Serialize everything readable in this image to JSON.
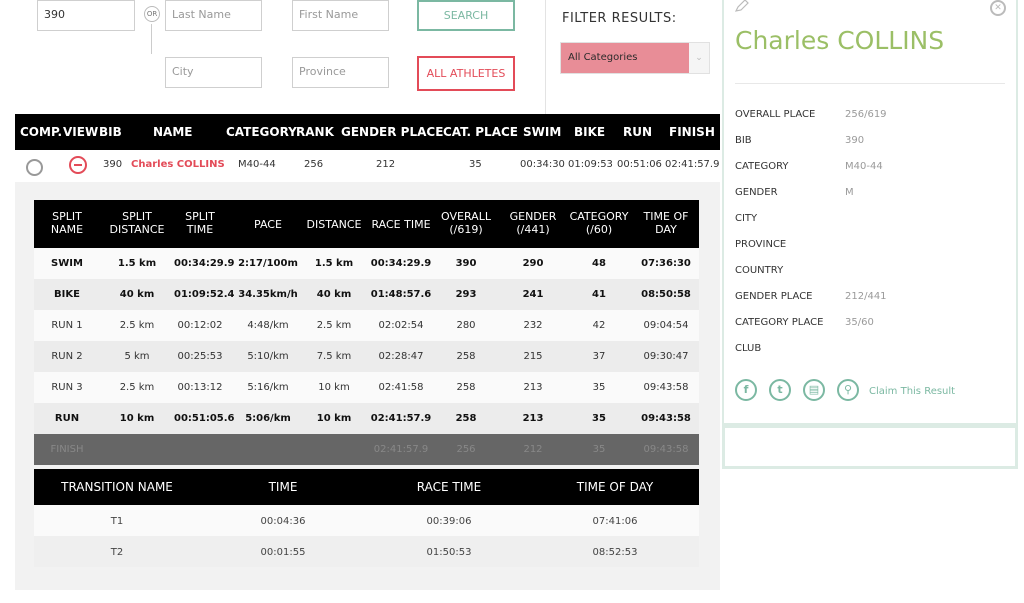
{
  "search": {
    "bib_value": "390",
    "or_label": "OR",
    "last_name_placeholder": "Last Name",
    "first_name_placeholder": "First Name",
    "city_placeholder": "City",
    "province_placeholder": "Province",
    "search_label": "SEARCH",
    "all_athletes_label": "ALL ATHLETES"
  },
  "filter": {
    "title": "FILTER RESULTS:",
    "selected": "All Categories"
  },
  "results": {
    "headers": [
      "COMP.",
      "VIEW",
      "BIB",
      "NAME",
      "CATEGORY",
      "RANK",
      "GENDER PLACE",
      "CAT. PLACE",
      "SWIM",
      "BIKE",
      "RUN",
      "FINISH"
    ],
    "row": {
      "bib": "390",
      "name": "Charles COLLINS",
      "category": "M40-44",
      "rank": "256",
      "gender_place": "212",
      "cat_place": "35",
      "swim": "00:34:30",
      "bike": "01:09:53",
      "run": "00:51:06",
      "finish": "02:41:57.9"
    }
  },
  "splits": {
    "headers": [
      "SPLIT NAME",
      "SPLIT DISTANCE",
      "SPLIT TIME",
      "PACE",
      "DISTANCE",
      "RACE TIME",
      "OVERALL (/619)",
      "GENDER (/441)",
      "CATEGORY (/60)",
      "TIME OF DAY"
    ],
    "rows": [
      {
        "bold": true,
        "cells": [
          "SWIM",
          "1.5 km",
          "00:34:29.9",
          "2:17/100m",
          "1.5 km",
          "00:34:29.9",
          "390",
          "290",
          "48",
          "07:36:30"
        ]
      },
      {
        "bold": true,
        "cells": [
          "BIKE",
          "40 km",
          "01:09:52.4",
          "34.35km/h",
          "40 km",
          "01:48:57.6",
          "293",
          "241",
          "41",
          "08:50:58"
        ]
      },
      {
        "bold": false,
        "cells": [
          "RUN 1",
          "2.5 km",
          "00:12:02",
          "4:48/km",
          "2.5 km",
          "02:02:54",
          "280",
          "232",
          "42",
          "09:04:54"
        ]
      },
      {
        "bold": false,
        "cells": [
          "RUN 2",
          "5 km",
          "00:25:53",
          "5:10/km",
          "7.5 km",
          "02:28:47",
          "258",
          "215",
          "37",
          "09:30:47"
        ]
      },
      {
        "bold": false,
        "cells": [
          "RUN 3",
          "2.5 km",
          "00:13:12",
          "5:16/km",
          "10 km",
          "02:41:58",
          "258",
          "213",
          "35",
          "09:43:58"
        ]
      },
      {
        "bold": true,
        "cells": [
          "RUN",
          "10 km",
          "00:51:05.6",
          "5:06/km",
          "10 km",
          "02:41:57.9",
          "258",
          "213",
          "35",
          "09:43:58"
        ]
      },
      {
        "bold": false,
        "finish": true,
        "cells": [
          "FINISH",
          "",
          "",
          "",
          "",
          "02:41:57.9",
          "256",
          "212",
          "35",
          "09:43:58"
        ]
      }
    ]
  },
  "transitions": {
    "headers": [
      "TRANSITION NAME",
      "TIME",
      "RACE TIME",
      "TIME OF DAY"
    ],
    "rows": [
      [
        "T1",
        "00:04:36",
        "00:39:06",
        "07:41:06"
      ],
      [
        "T2",
        "00:01:55",
        "01:50:53",
        "08:52:53"
      ]
    ]
  },
  "athlete": {
    "name": "Charles COLLINS",
    "fields": [
      {
        "label": "OVERALL PLACE",
        "value": "256/619"
      },
      {
        "label": "BIB",
        "value": "390"
      },
      {
        "label": "CATEGORY",
        "value": "M40-44"
      },
      {
        "label": "GENDER",
        "value": "M"
      },
      {
        "label": "CITY",
        "value": ""
      },
      {
        "label": "PROVINCE",
        "value": ""
      },
      {
        "label": "COUNTRY",
        "value": ""
      },
      {
        "label": "GENDER PLACE",
        "value": "212/441"
      },
      {
        "label": "CATEGORY PLACE",
        "value": "35/60"
      },
      {
        "label": "CLUB",
        "value": ""
      }
    ],
    "claim_label": "Claim This Result",
    "icons": [
      "facebook-icon",
      "twitter-icon",
      "document-icon",
      "search-icon"
    ]
  },
  "colors": {
    "accent_green": "#7bb8a2",
    "accent_red": "#e34b58",
    "name_green": "#9bbf66"
  }
}
